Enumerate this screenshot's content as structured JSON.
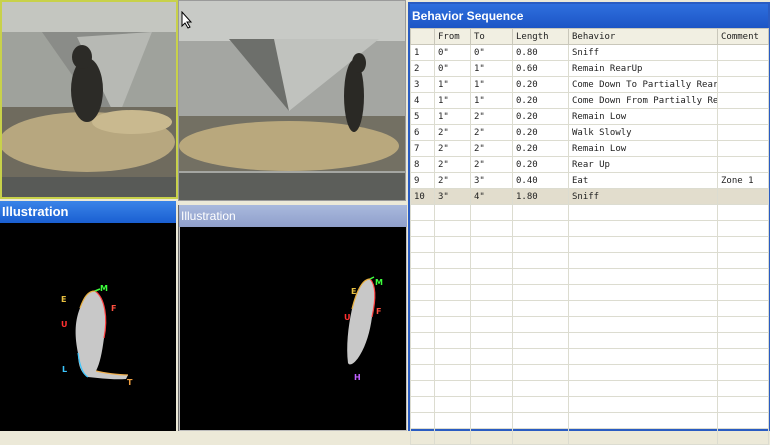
{
  "illustration_left": {
    "title": "Illustration",
    "labels": {
      "e": "E",
      "m": "M",
      "u": "U",
      "f": "F",
      "l": "L",
      "t": "T"
    }
  },
  "illustration_right": {
    "title": "Illustration",
    "labels": {
      "e": "E",
      "m": "M",
      "u": "U",
      "f": "F",
      "h": "H"
    }
  },
  "behavior_sequence": {
    "title": "Behavior Sequence",
    "columns": [
      "",
      "From",
      "To",
      "Length",
      "Behavior",
      "Comment"
    ],
    "rows": [
      {
        "n": "1",
        "from": "0\"",
        "to": "0\"",
        "length": "0.80",
        "behavior": "Sniff",
        "comment": ""
      },
      {
        "n": "2",
        "from": "0\"",
        "to": "1\"",
        "length": "0.60",
        "behavior": "Remain RearUp",
        "comment": ""
      },
      {
        "n": "3",
        "from": "1\"",
        "to": "1\"",
        "length": "0.20",
        "behavior": "Come Down To Partially Reared",
        "comment": ""
      },
      {
        "n": "4",
        "from": "1\"",
        "to": "1\"",
        "length": "0.20",
        "behavior": "Come Down From Partially Reared",
        "comment": ""
      },
      {
        "n": "5",
        "from": "1\"",
        "to": "2\"",
        "length": "0.20",
        "behavior": "Remain Low",
        "comment": ""
      },
      {
        "n": "6",
        "from": "2\"",
        "to": "2\"",
        "length": "0.20",
        "behavior": "Walk Slowly",
        "comment": ""
      },
      {
        "n": "7",
        "from": "2\"",
        "to": "2\"",
        "length": "0.20",
        "behavior": "Remain Low",
        "comment": ""
      },
      {
        "n": "8",
        "from": "2\"",
        "to": "2\"",
        "length": "0.20",
        "behavior": "Rear Up",
        "comment": ""
      },
      {
        "n": "9",
        "from": "2\"",
        "to": "3\"",
        "length": "0.40",
        "behavior": "Eat",
        "comment": "Zone 1"
      },
      {
        "n": "10",
        "from": "3\"",
        "to": "4\"",
        "length": "1.80",
        "behavior": "Sniff",
        "comment": ""
      }
    ],
    "selected_row": "10",
    "empty_rows": 15
  }
}
